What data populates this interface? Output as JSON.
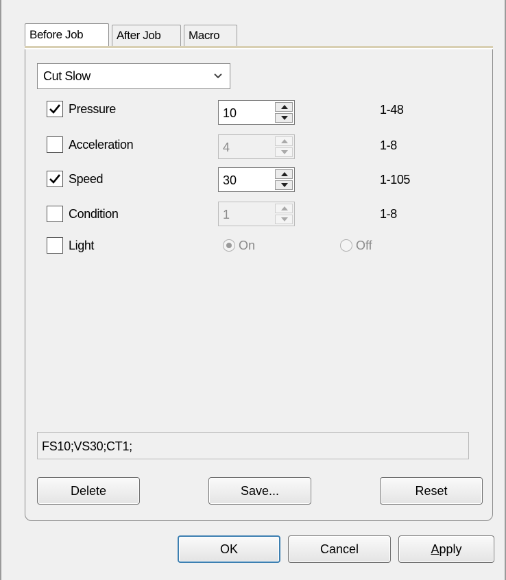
{
  "tabs": [
    {
      "label": "Before Job",
      "active": true
    },
    {
      "label": "After Job",
      "active": false
    },
    {
      "label": "Macro",
      "active": false
    }
  ],
  "preset": {
    "selected": "Cut Slow"
  },
  "settings": [
    {
      "label": "Pressure",
      "checked": true,
      "value": "10",
      "range": "1-48",
      "enabled": true
    },
    {
      "label": "Acceleration",
      "checked": false,
      "value": "4",
      "range": "1-8",
      "enabled": false
    },
    {
      "label": "Speed",
      "checked": true,
      "value": "30",
      "range": "1-105",
      "enabled": true
    },
    {
      "label": "Condition",
      "checked": false,
      "value": "1",
      "range": "1-8",
      "enabled": false
    }
  ],
  "light": {
    "label": "Light",
    "checked": false,
    "on_label": "On",
    "off_label": "Off",
    "selected": "On"
  },
  "command_string": "FS10;VS30;CT1;",
  "panel_buttons": {
    "delete": "Delete",
    "save": "Save...",
    "reset": "Reset"
  },
  "dialog_buttons": {
    "ok": "OK",
    "cancel": "Cancel",
    "apply_accel": "A",
    "apply_rest": "pply"
  }
}
